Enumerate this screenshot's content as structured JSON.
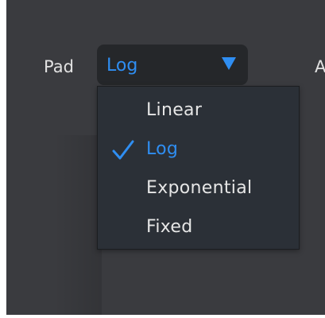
{
  "param": {
    "label": "Pad",
    "right_label": "A"
  },
  "dropdown": {
    "value": "Log",
    "arrow_icon": "triangle-down-icon"
  },
  "menu": {
    "items": [
      {
        "label": "Linear",
        "selected": false
      },
      {
        "label": "Log",
        "selected": true
      },
      {
        "label": "Exponential",
        "selected": false
      },
      {
        "label": "Fixed",
        "selected": false
      }
    ],
    "check_icon": "checkmark-icon"
  },
  "colors": {
    "panel_bg": "#3a3b3f",
    "dropdown_bg": "#25272a",
    "menu_bg": "#2b3037",
    "accent": "#2f8ef2",
    "text": "#e6e6e6"
  }
}
